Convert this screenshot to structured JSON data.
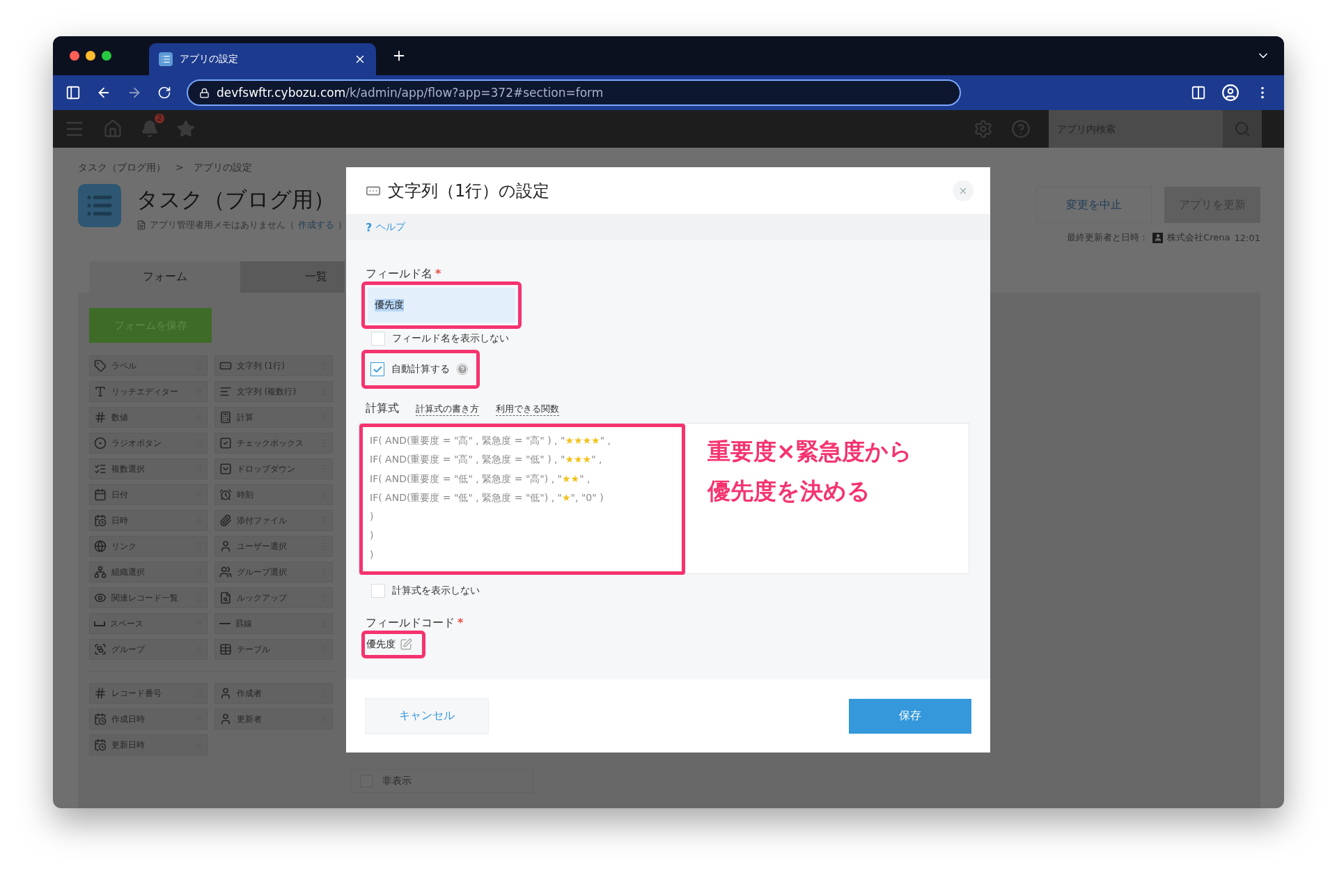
{
  "browser": {
    "tab": {
      "title": "アプリの設定"
    },
    "url": {
      "host": "devfswftr.cybozu.com",
      "path": "/k/admin/app/flow?app=372#section=form"
    }
  },
  "header": {
    "notification_count": "2",
    "search": {
      "placeholder": "アプリ内検索"
    }
  },
  "breadcrumb": {
    "items": [
      "タスク（ブログ用）",
      "アプリの設定"
    ],
    "separator": ">"
  },
  "app": {
    "title": "タスク（ブログ用）",
    "memo": "アプリ管理者用メモはありません（",
    "memo_link": "作成する",
    "memo_end": "）"
  },
  "actions": {
    "cancel": "変更を中止",
    "update": "アプリを更新",
    "last_updated_label": "最終更新者と日時：",
    "last_updated_user": "株式会社Crena",
    "last_updated_time": "12:01"
  },
  "tabs": [
    {
      "label": "フォーム",
      "selected": true
    },
    {
      "label": "一覧",
      "selected": false
    }
  ],
  "palette": {
    "save_button": "フォームを保存",
    "fields": [
      {
        "label": "ラベル",
        "kind": "label"
      },
      {
        "label": "文字列 (1行)",
        "kind": "text_single"
      },
      {
        "label": "リッチエディター",
        "kind": "rich_editor"
      },
      {
        "label": "文字列 (複数行)",
        "kind": "text_multi"
      },
      {
        "label": "数値",
        "kind": "number"
      },
      {
        "label": "計算",
        "kind": "calc"
      },
      {
        "label": "ラジオボタン",
        "kind": "radio"
      },
      {
        "label": "チェックボックス",
        "kind": "checkbox"
      },
      {
        "label": "複数選択",
        "kind": "multi_select"
      },
      {
        "label": "ドロップダウン",
        "kind": "dropdown"
      },
      {
        "label": "日付",
        "kind": "date"
      },
      {
        "label": "時刻",
        "kind": "time"
      },
      {
        "label": "日時",
        "kind": "datetime"
      },
      {
        "label": "添付ファイル",
        "kind": "attachment"
      },
      {
        "label": "リンク",
        "kind": "link"
      },
      {
        "label": "ユーザー選択",
        "kind": "user"
      },
      {
        "label": "組織選択",
        "kind": "org"
      },
      {
        "label": "グループ選択",
        "kind": "group_select"
      },
      {
        "label": "関連レコード一覧",
        "kind": "related"
      },
      {
        "label": "ルックアップ",
        "kind": "lookup"
      },
      {
        "label": "スペース",
        "kind": "space"
      },
      {
        "label": "罫線",
        "kind": "divider"
      },
      {
        "label": "グループ",
        "kind": "group"
      },
      {
        "label": "テーブル",
        "kind": "table"
      }
    ],
    "system_fields": [
      {
        "label": "レコード番号",
        "kind": "number"
      },
      {
        "label": "作成者",
        "kind": "user"
      },
      {
        "label": "作成日時",
        "kind": "datetime"
      },
      {
        "label": "更新者",
        "kind": "user"
      },
      {
        "label": "更新日時",
        "kind": "datetime"
      }
    ]
  },
  "form_canvas": {
    "hidden_checkbox": {
      "label": "非表示",
      "checked": false
    }
  },
  "dialog": {
    "title": "文字列（1行）の設定",
    "help_mark": "?",
    "help": "ヘルプ",
    "field_name": {
      "label": "フィールド名",
      "required_mark": "*",
      "value": "優先度",
      "highlighted": true
    },
    "hide_field_name": {
      "label": "フィールド名を表示しない",
      "checked": false
    },
    "auto_calc": {
      "label": "自動計算する",
      "checked": true,
      "highlighted": true
    },
    "formula": {
      "label": "計算式",
      "links": [
        "計算式の書き方",
        "利用できる関数"
      ],
      "highlighted": true,
      "lines": [
        {
          "code": "IF( AND(重要度 = \"高\" , 緊急度 = \"高\" ) , \"",
          "emoji": "★★★★",
          "code_end": "\" ,"
        },
        {
          "code": "IF( AND(重要度 = \"高\" , 緊急度 = \"低\" ) , \"",
          "emoji": "★★★",
          "code_end": "\" ,"
        },
        {
          "code": "IF( AND(重要度 = \"低\" , 緊急度 = \"高\") , \"",
          "emoji": "★★",
          "code_end": "\" ,"
        },
        {
          "code": "IF( AND(重要度 = \"低\" , 緊急度 = \"低\") , \"",
          "emoji": "★",
          "code_end": "\", \"0\" )"
        },
        {
          "code": ")"
        },
        {
          "code": ")"
        },
        {
          "code": ")"
        }
      ]
    },
    "annotation": [
      "重要度×緊急度から",
      "優先度を決める"
    ],
    "hide_formula": {
      "label": "計算式を表示しない",
      "checked": false
    },
    "field_code": {
      "label": "フィールドコード",
      "required_mark": "*",
      "value": "優先度",
      "highlighted": true
    },
    "buttons": {
      "cancel": "キャンセル",
      "save": "保存"
    }
  }
}
